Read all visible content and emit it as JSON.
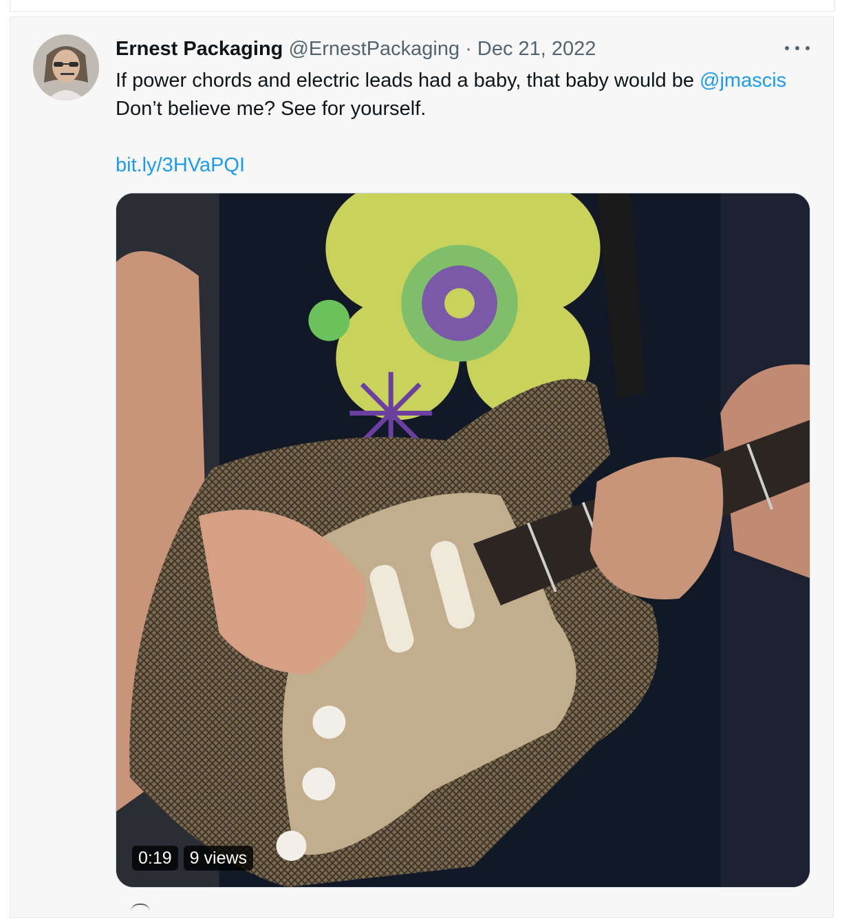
{
  "tweet": {
    "author_name": "Ernest Packaging",
    "handle": "@ErnestPackaging",
    "separator": "·",
    "date": "Dec 21, 2022",
    "line1_text": "If power chords and electric leads had a baby, that baby would be ",
    "mention": "@jmascis",
    "line2_text": "Don’t believe me? See for yourself.",
    "link": "bit.ly/3HVaPQI",
    "more_icon": "more-horizontal-icon"
  },
  "video": {
    "duration": "0:19",
    "views": "9 views"
  },
  "colors": {
    "accent": "#1d9bf0",
    "text": "#0f1419",
    "secondary": "#536471",
    "card_bg": "#f7f7f7"
  }
}
